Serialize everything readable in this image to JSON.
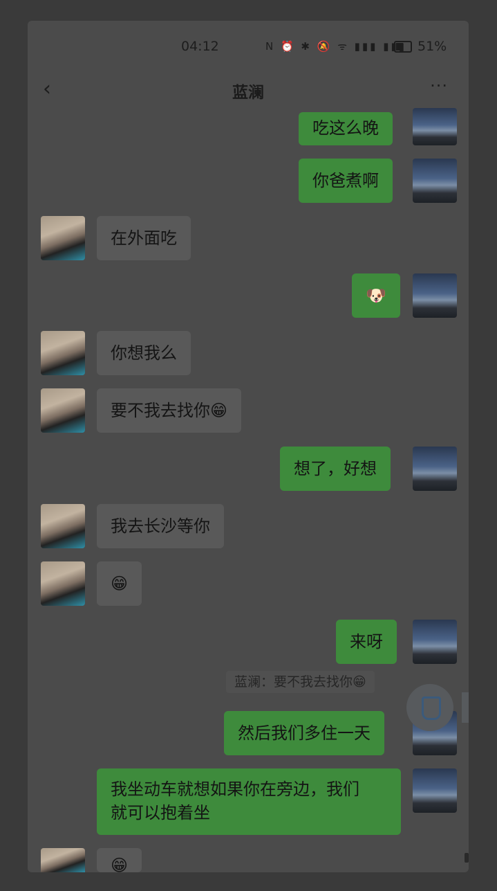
{
  "status_bar": {
    "time": "04:12",
    "icons_text": "N ⏰ ✱ 🔕 ᯤ ▮▮▮ ▮▮▮",
    "battery": "51%"
  },
  "header": {
    "title": "蓝澜",
    "back_glyph": "‹",
    "more_glyph": "···"
  },
  "messages": {
    "m1": "吃这么晚",
    "m2": "你爸煮啊",
    "m3": "在外面吃",
    "m4": "🐶",
    "m5": "你想我么",
    "m6": "要不我去找你😁",
    "m7": "想了，好想",
    "m8": "我去长沙等你",
    "m9": "😁",
    "m10": "来呀",
    "quote": "蓝澜：要不我去找你😁",
    "m11": "然后我们多住一天",
    "m12_line1": "我坐动车就想如果你在旁边，我们",
    "m12_line2": "就可以抱着坐",
    "m13": "😁"
  },
  "colors": {
    "outgoing_bubble": "#3e8b3c",
    "incoming_bubble": "#595959",
    "overlay_background": "#3a3a3a"
  },
  "icons": {
    "back": "chevron-left-icon",
    "more": "more-dots-icon",
    "fab": "shield-icon"
  }
}
